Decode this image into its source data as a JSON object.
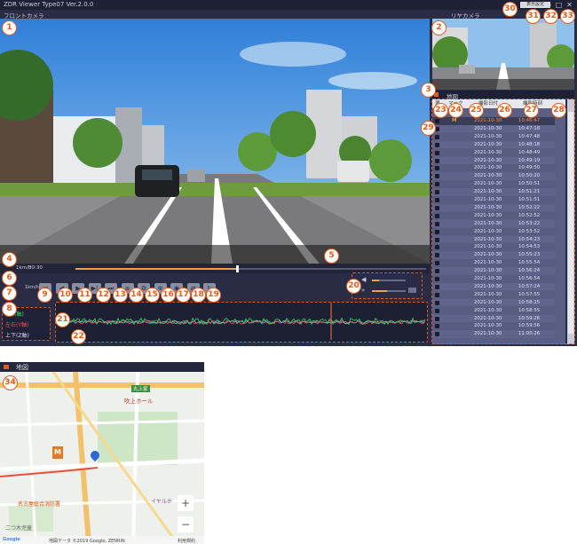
{
  "app": {
    "title": "ZDR Viewer Type07 Ver.2.0.0",
    "front_label": "フロントカメラ",
    "rear_label": "リヤカメラ",
    "map_header": "地図",
    "menu_label": "表示設定",
    "window_controls": [
      "—",
      "□",
      "✕"
    ]
  },
  "player": {
    "speed": "1km/h",
    "time": "00:30",
    "progress_fraction": 0.46,
    "volume_fraction": 0.2,
    "playback_rate_fraction": 0.45
  },
  "axes_panel": {
    "x_label": "前(X軸)",
    "y_label": "左右(Y軸)",
    "z_label": "上下(Z軸)"
  },
  "file_list": {
    "headers": [
      "選",
      "マーク",
      "撮影日付",
      "撮影時刻"
    ],
    "rows": [
      {
        "mark": "M",
        "date": "2021-10-30",
        "time": "10:46:47",
        "active": true
      },
      {
        "mark": "",
        "date": "2021-10-30",
        "time": "10:47:18",
        "active": false
      },
      {
        "mark": "",
        "date": "2021-10-30",
        "time": "10:47:48",
        "active": false
      },
      {
        "mark": "",
        "date": "2021-10-30",
        "time": "10:48:18",
        "active": false
      },
      {
        "mark": "",
        "date": "2021-10-30",
        "time": "10:48:49",
        "active": false
      },
      {
        "mark": "",
        "date": "2021-10-30",
        "time": "10:49:19",
        "active": false
      },
      {
        "mark": "",
        "date": "2021-10-30",
        "time": "10:49:50",
        "active": false
      },
      {
        "mark": "",
        "date": "2021-10-30",
        "time": "10:50:20",
        "active": false
      },
      {
        "mark": "",
        "date": "2021-10-30",
        "time": "10:50:51",
        "active": false
      },
      {
        "mark": "",
        "date": "2021-10-30",
        "time": "10:51:21",
        "active": false
      },
      {
        "mark": "",
        "date": "2021-10-30",
        "time": "10:51:51",
        "active": false
      },
      {
        "mark": "",
        "date": "2021-10-30",
        "time": "10:52:22",
        "active": false
      },
      {
        "mark": "",
        "date": "2021-10-30",
        "time": "10:52:52",
        "active": false
      },
      {
        "mark": "",
        "date": "2021-10-30",
        "time": "10:53:22",
        "active": false
      },
      {
        "mark": "",
        "date": "2021-10-30",
        "time": "10:53:52",
        "active": false
      },
      {
        "mark": "",
        "date": "2021-10-30",
        "time": "10:54:23",
        "active": false
      },
      {
        "mark": "",
        "date": "2021-10-30",
        "time": "10:54:53",
        "active": false
      },
      {
        "mark": "",
        "date": "2021-10-30",
        "time": "10:55:23",
        "active": false
      },
      {
        "mark": "",
        "date": "2021-10-30",
        "time": "10:55:54",
        "active": false
      },
      {
        "mark": "",
        "date": "2021-10-30",
        "time": "10:56:24",
        "active": false
      },
      {
        "mark": "",
        "date": "2021-10-30",
        "time": "10:56:54",
        "active": false
      },
      {
        "mark": "",
        "date": "2021-10-30",
        "time": "10:57:24",
        "active": false
      },
      {
        "mark": "",
        "date": "2021-10-30",
        "time": "10:57:55",
        "active": false
      },
      {
        "mark": "",
        "date": "2021-10-30",
        "time": "10:58:25",
        "active": false
      },
      {
        "mark": "",
        "date": "2021-10-30",
        "time": "10:58:55",
        "active": false
      },
      {
        "mark": "",
        "date": "2021-10-30",
        "time": "10:59:26",
        "active": false
      },
      {
        "mark": "",
        "date": "2021-10-30",
        "time": "10:59:56",
        "active": false
      },
      {
        "mark": "",
        "date": "2021-10-30",
        "time": "11:00:26",
        "active": false
      }
    ]
  },
  "callouts": [
    "1",
    "2",
    "3",
    "4",
    "5",
    "6",
    "7",
    "8",
    "9",
    "10",
    "11",
    "12",
    "13",
    "14",
    "15",
    "16",
    "17",
    "18",
    "19",
    "20",
    "21",
    "22",
    "23",
    "24",
    "25",
    "26",
    "27",
    "28",
    "29",
    "30",
    "31",
    "32",
    "33",
    "34"
  ],
  "controls": {
    "icons": [
      "skip-back-icon",
      "step-back-icon",
      "play-icon",
      "step-forward-icon",
      "skip-forward-icon",
      "frame-back-icon",
      "frame-forward-icon",
      "zoom-icon",
      "snapshot-icon",
      "camera-switch-icon",
      "rotate-icon"
    ]
  },
  "map": {
    "places": [
      "吹上ホール",
      "丸上家",
      "吹上",
      "名古屋総合消防署",
      "イヤルホ",
      "二つ木児童",
      "Google",
      "地図データ ©2019 Google, ZENRIN",
      "利用規約"
    ],
    "zoom_in": "+",
    "zoom_out": "−"
  },
  "colors": {
    "accent": "#e25c1d",
    "list_bg": "#5a6083",
    "list_active": "#3a3d57",
    "frame_bg": "#2a2c45"
  }
}
